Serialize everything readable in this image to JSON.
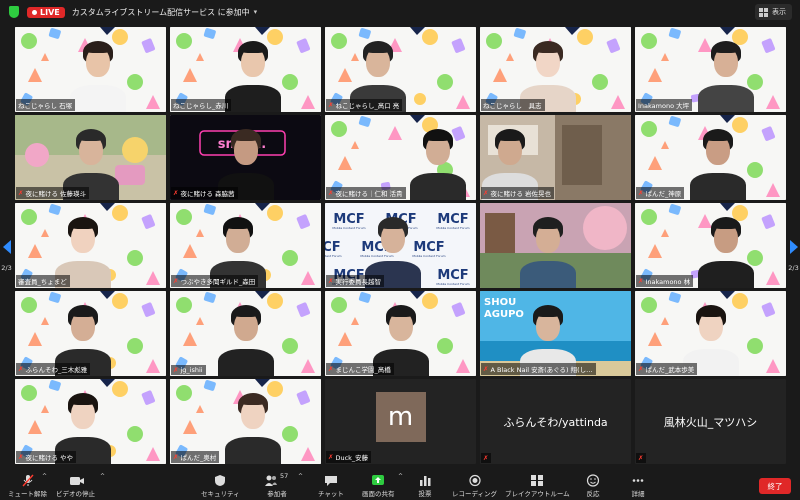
{
  "topbar": {
    "live_label": "LIVE",
    "meeting_title": "カスタムライブストリーム配信サービス に参加中",
    "view_label": "表示"
  },
  "pager": {
    "page_text": "2/3"
  },
  "tiles": [
    {
      "name": "ねこじゃらし 石塚",
      "muted": false
    },
    {
      "name": "ねこじゃらし_赤川",
      "muted": false
    },
    {
      "name": "ねこじゃらし_髙口 亮",
      "muted": true
    },
    {
      "name": "ねこじゃらし　具志",
      "muted": false
    },
    {
      "name": "Inakamono 大坪",
      "muted": false
    },
    {
      "name": "夜に賭ける 佐藤瑛斗",
      "muted": true
    },
    {
      "name": "夜に賭ける 森脇茜",
      "muted": true
    },
    {
      "name": "夜に賭ける｜仁和 活貴",
      "muted": true
    },
    {
      "name": "夜に賭ける 岩佐晃也",
      "muted": true
    },
    {
      "name": "ぱんだ_神原",
      "muted": true
    },
    {
      "name": "審査員_ちょまど",
      "muted": false
    },
    {
      "name": "つぶやき多聞ギルド_森田",
      "muted": true
    },
    {
      "name": "実行委員長越智",
      "muted": true
    },
    {
      "name": "",
      "muted": false
    },
    {
      "name": "Inakamono 林",
      "muted": true
    },
    {
      "name": "ふらんそわ_三木彪雅",
      "muted": true
    },
    {
      "name": "jg_ishii",
      "muted": true
    },
    {
      "name": "まじんこ学園_髙橋",
      "muted": true
    },
    {
      "name": "A Black Nail 安斎(あぐる) 翔(し…",
      "muted": true
    },
    {
      "name": "ぱんだ_武本歩美",
      "muted": true
    },
    {
      "name": "夜に賭ける やや",
      "muted": true
    },
    {
      "name": "ぱんだ_奥村",
      "muted": true
    },
    {
      "name": "Duck_安藤",
      "muted": true,
      "avatar_letter": "m"
    },
    {
      "name": "ふらんそわ/yattinda",
      "muted": true,
      "name_only": true
    },
    {
      "name": "風林火山_マツハシ",
      "muted": true,
      "name_only": true
    }
  ],
  "toolbar": {
    "mute": "ミュート解除",
    "video": "ビデオの停止",
    "security": "セキュリティ",
    "participants": "参加者",
    "participants_count": "57",
    "chat": "チャット",
    "share": "画面の共有",
    "poll": "投票",
    "record": "レコーディング",
    "breakout": "ブレイクアウトルーム",
    "reactions": "反応",
    "more": "詳細",
    "end": "終了"
  },
  "logo_texts": {
    "mcf": "MCF",
    "mcf_sub": "Mobile Content Forum",
    "neon": "sm@h.",
    "shou": "SHOU",
    "agupo": "AGUPO"
  },
  "colors": {
    "live_red": "#e02828",
    "accent_blue": "#2f8cff",
    "share_green": "#2ecc40",
    "mute_red": "#ff3b30"
  }
}
